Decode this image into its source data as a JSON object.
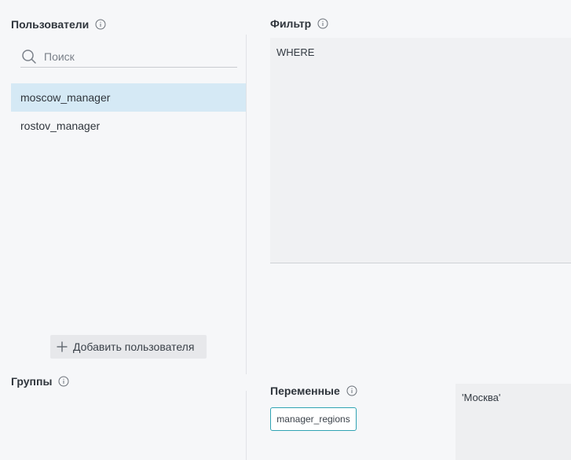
{
  "users": {
    "title": "Пользователи",
    "search_placeholder": "Поиск",
    "items": [
      {
        "label": "moscow_manager",
        "selected": true
      },
      {
        "label": "rostov_manager",
        "selected": false
      }
    ],
    "add_button_label": "Добавить пользователя"
  },
  "filter": {
    "title": "Фильтр",
    "text": "WHERE"
  },
  "groups": {
    "title": "Группы"
  },
  "variables": {
    "title": "Переменные",
    "items": [
      {
        "label": "manager_regions"
      }
    ],
    "value": "'Москва'"
  },
  "colors": {
    "selected_row": "#d5e9f5",
    "chip_border": "#2fa3b3",
    "background": "#f6f7f9"
  },
  "icons": [
    "info-icon",
    "search-icon",
    "plus-icon"
  ]
}
